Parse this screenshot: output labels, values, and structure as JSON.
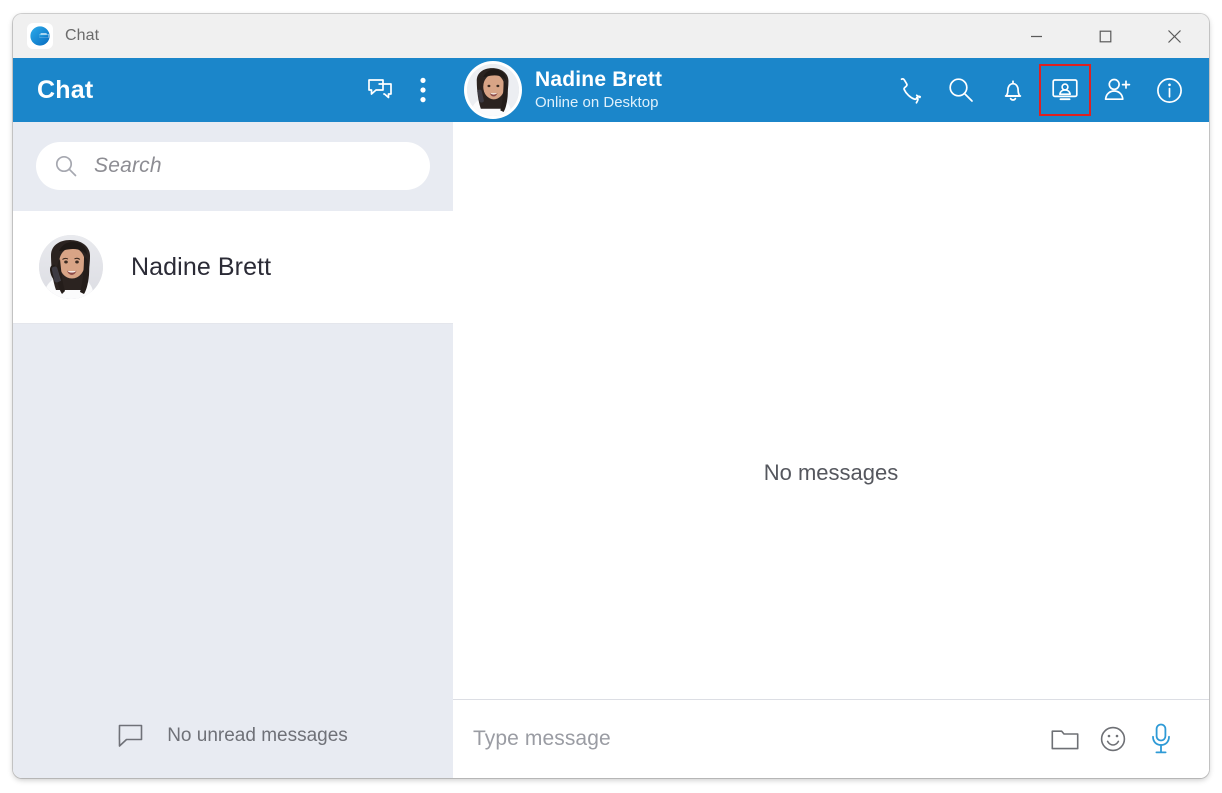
{
  "window": {
    "app_icon": "chat-logo-icon",
    "title": "Chat",
    "controls": {
      "minimize": "minimize-icon",
      "maximize": "maximize-icon",
      "close": "close-icon"
    },
    "accent_color": "#1b86ca",
    "sidebar_bg": "#e8ebf2",
    "mic_color": "#2e9ad6",
    "highlight_color": "#e02020"
  },
  "sidebar": {
    "header": {
      "title": "Chat",
      "new_chat_icon": "new-chat-icon",
      "menu_icon": "more-vertical-icon"
    },
    "search": {
      "placeholder": "Search",
      "value": "",
      "icon": "search-icon"
    },
    "contacts": [
      {
        "name": "Nadine Brett",
        "avatar": "nadine-brett-avatar"
      }
    ],
    "footer": {
      "icon": "message-bubble-icon",
      "label": "No unread messages"
    }
  },
  "chat": {
    "header": {
      "peer_name": "Nadine Brett",
      "peer_status": "Online on Desktop",
      "peer_avatar": "nadine-brett-avatar",
      "actions": [
        {
          "name": "call-icon",
          "label": "Call",
          "selected": false
        },
        {
          "name": "search-icon",
          "label": "Search",
          "selected": false
        },
        {
          "name": "notification-bell-icon",
          "label": "Notifications",
          "selected": false
        },
        {
          "name": "screen-share-icon",
          "label": "Meet now",
          "selected": true
        },
        {
          "name": "add-person-icon",
          "label": "Add people",
          "selected": false
        },
        {
          "name": "info-icon",
          "label": "Info",
          "selected": false
        }
      ]
    },
    "empty_state": "No messages",
    "composer": {
      "placeholder": "Type message",
      "value": "",
      "buttons": [
        {
          "name": "attach-folder-icon",
          "label": "Attach file"
        },
        {
          "name": "emoji-icon",
          "label": "Emoji"
        },
        {
          "name": "microphone-icon",
          "label": "Voice message"
        }
      ]
    }
  }
}
